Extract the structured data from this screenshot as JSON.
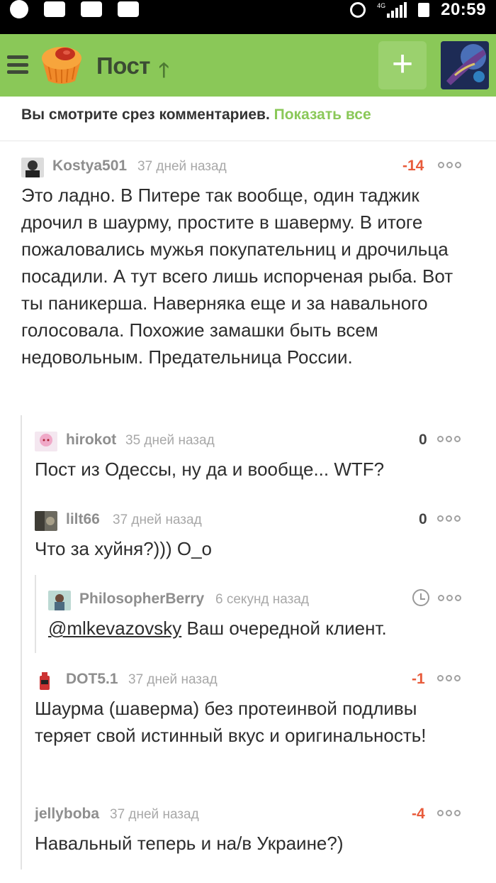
{
  "status_bar": {
    "time": "20:59",
    "network": "4G",
    "icons": [
      "whatsapp-icon",
      "image-icon",
      "mail-icon",
      "youtube-icon",
      "alarm-icon",
      "signal-icon",
      "battery-icon"
    ]
  },
  "header": {
    "title": "Пост",
    "add_label": "+",
    "accent_color": "#8ac858"
  },
  "notice": {
    "text": "Вы смотрите срез комментариев.",
    "link": "Показать все"
  },
  "comments": [
    {
      "user": "Kostya501",
      "time": "37 дней назад",
      "rating": "-14",
      "text": "Это ладно. В Питере так вообще, один таджик дрочил в шаурму, простите в шаверму. В итоге пожаловались мужья покупательниц и дрочильца посадили. А тут всего лишь испорченая рыба. Вот ты паникерша. Наверняка еще и за навального голосовала. Похожие замашки быть всем недовольным. Предательница России."
    },
    {
      "user": "hirokot",
      "time": "35 дней назад",
      "rating": "0",
      "text": "Пост из Одессы, ну да и вообще... WTF?"
    },
    {
      "user": "lilt66",
      "time": "37 дней назад",
      "rating": "0",
      "text": "Что за хуйня?))) О_о"
    },
    {
      "user": "PhilosopherBerry",
      "time": "6 секунд назад",
      "mention": "@mlkevazovsky",
      "text": " Ваш очередной клиент."
    },
    {
      "user": "DOT5.1",
      "time": "37 дней назад",
      "rating": "-1",
      "text": "Шаурма (шаверма) без протеинвой подливы теряет свой истинный вкус и оригинальность!"
    },
    {
      "user": "jellyboba",
      "time": "37 дней назад",
      "rating": "-4",
      "text": "Навальный теперь и на/в Украине?)"
    }
  ]
}
